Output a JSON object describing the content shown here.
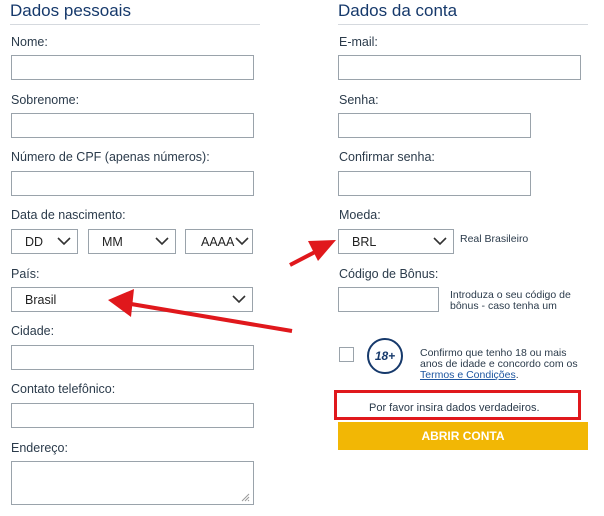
{
  "personal": {
    "title": "Dados pessoais",
    "nome": "Nome:",
    "sobrenome": "Sobrenome:",
    "cpf": "Número de CPF (apenas números):",
    "nascimento": "Data de nascimento:",
    "day": "DD",
    "month": "MM",
    "year": "AAAA",
    "pais": "País:",
    "pais_value": "Brasil",
    "cidade": "Cidade:",
    "telefone": "Contato telefônico:",
    "endereco": "Endereço:"
  },
  "account": {
    "title": "Dados da conta",
    "email": "E-mail:",
    "senha": "Senha:",
    "confirmar": "Confirmar senha:",
    "moeda": "Moeda:",
    "moeda_value": "BRL",
    "moeda_name": "Real Brasileiro",
    "bonus": "Código de Bônus:",
    "bonus_hint_1": "Introduza o seu código de",
    "bonus_hint_2": "bônus - caso tenha um",
    "age_badge": "18+",
    "confirm_1": "Confirmo que tenho 18 ou mais",
    "confirm_2": "anos de idade e concordo com os",
    "terms": "Termos e Condições",
    "terms_suffix": ".",
    "notice": "Por favor insira dados verdadeiros.",
    "submit": "ABRIR CONTA"
  },
  "colors": {
    "title": "#16396b",
    "button": "#f2b705",
    "highlight": "#e0181c"
  }
}
